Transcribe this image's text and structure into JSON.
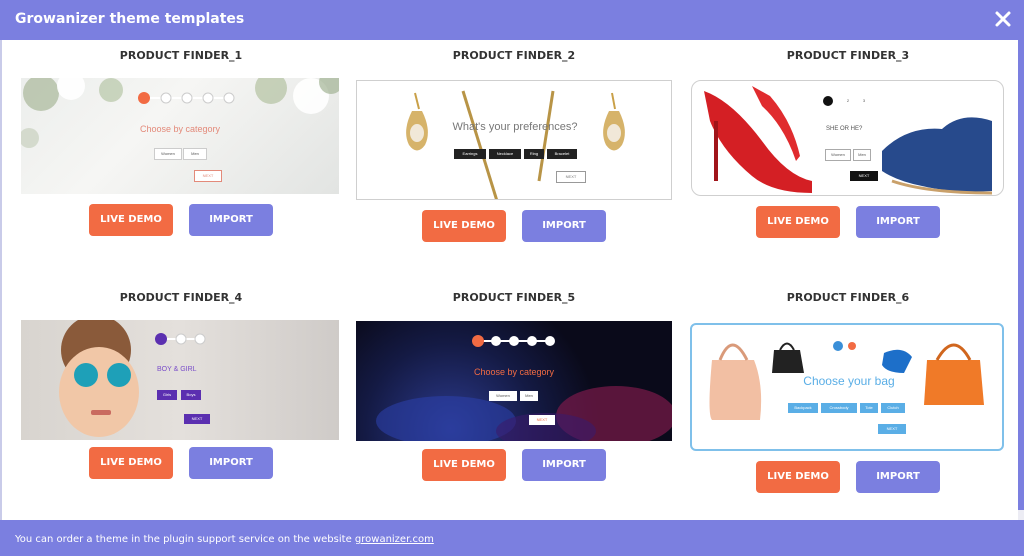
{
  "dialog": {
    "title": "Growanizer theme templates",
    "close_icon": "close-icon"
  },
  "templates": [
    {
      "name": "PRODUCT FINDER_1",
      "live_demo": "LIVE DEMO",
      "import": "IMPORT",
      "preview": {
        "heading": "Choose by category",
        "options": [
          "Women",
          "Men"
        ],
        "next": "NEXT"
      }
    },
    {
      "name": "PRODUCT FINDER_2",
      "live_demo": "LIVE DEMO",
      "import": "IMPORT",
      "preview": {
        "heading": "What's your preferences?",
        "options": [
          "Earrings",
          "Necklace",
          "Ring",
          "Bracelet"
        ],
        "next": "NEXT"
      }
    },
    {
      "name": "PRODUCT FINDER_3",
      "live_demo": "LIVE DEMO",
      "import": "IMPORT",
      "preview": {
        "heading": "SHE OR HE?",
        "options": [
          "Women",
          "Men"
        ],
        "next": "NEXT",
        "steps": [
          "1",
          "2",
          "3"
        ]
      }
    },
    {
      "name": "PRODUCT FINDER_4",
      "live_demo": "LIVE DEMO",
      "import": "IMPORT",
      "preview": {
        "heading": "BOY & GIRL",
        "options": [
          "Girls",
          "Boys"
        ],
        "next": "NEXT"
      }
    },
    {
      "name": "PRODUCT FINDER_5",
      "live_demo": "LIVE DEMO",
      "import": "IMPORT",
      "preview": {
        "heading": "Choose by category",
        "options": [
          "Women",
          "Men"
        ],
        "next": "NEXT"
      }
    },
    {
      "name": "PRODUCT FINDER_6",
      "live_demo": "LIVE DEMO",
      "import": "IMPORT",
      "preview": {
        "heading": "Choose your bag",
        "options": [
          "Backpack",
          "Crossbody",
          "Tote",
          "Clutch"
        ],
        "next": "NEXT"
      }
    }
  ],
  "footer": {
    "text": "You can order a theme in the plugin support service on the website ",
    "link": "growanizer.com"
  },
  "colors": {
    "accent": "#7b7fe0",
    "live_demo": "#f26b43"
  }
}
